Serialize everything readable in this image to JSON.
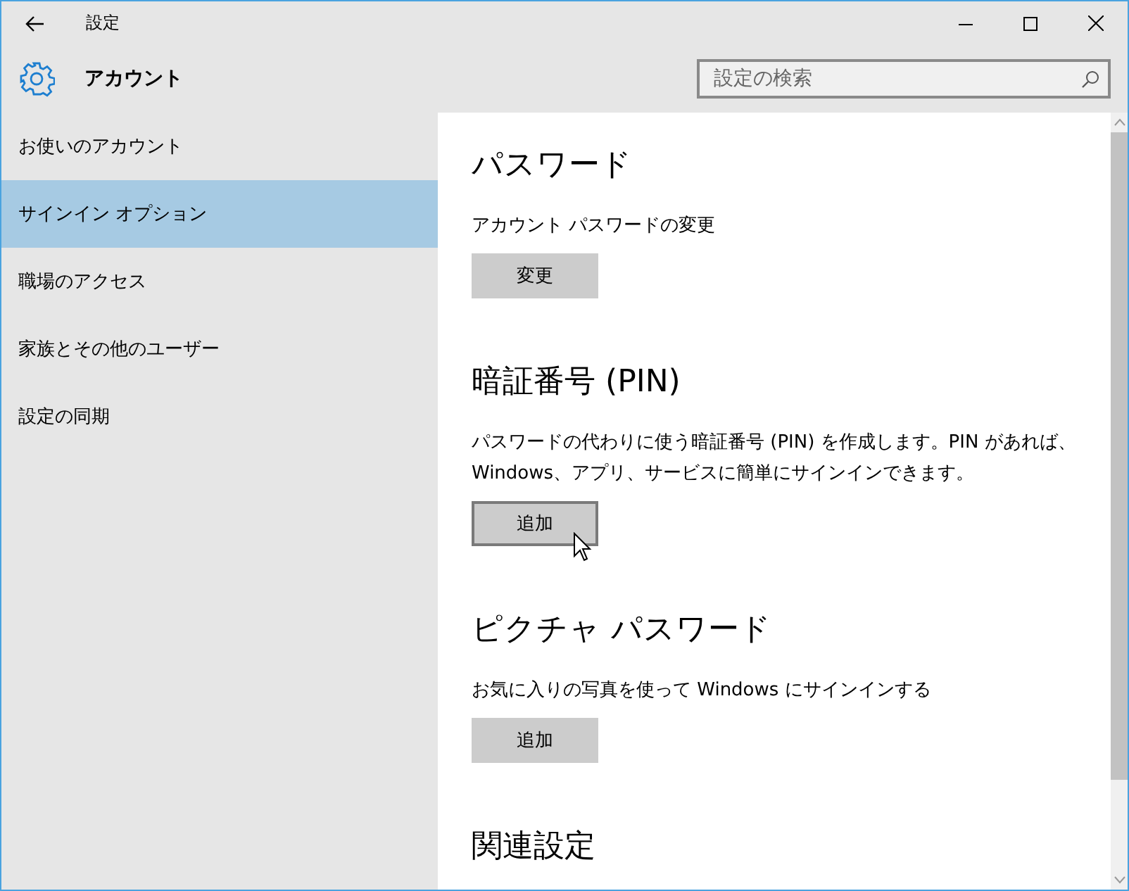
{
  "window": {
    "title": "設定"
  },
  "header": {
    "title": "アカウント",
    "search": {
      "placeholder": "設定の検索"
    }
  },
  "sidebar": {
    "items": [
      {
        "label": "お使いのアカウント",
        "selected": false
      },
      {
        "label": "サインイン オプション",
        "selected": true
      },
      {
        "label": "職場のアクセス",
        "selected": false
      },
      {
        "label": "家族とその他のユーザー",
        "selected": false
      },
      {
        "label": "設定の同期",
        "selected": false
      }
    ]
  },
  "sections": [
    {
      "heading": "パスワード",
      "description": "アカウント パスワードの変更",
      "button": {
        "label": "変更",
        "hovered": false
      }
    },
    {
      "heading": "暗証番号 (PIN)",
      "description": "パスワードの代わりに使う暗証番号 (PIN) を作成します。PIN があれば、Windows、アプリ、サービスに簡単にサインインできます。",
      "button": {
        "label": "追加",
        "hovered": true
      }
    },
    {
      "heading": "ピクチャ パスワード",
      "description": "お気に入りの写真を使って Windows にサインインする",
      "button": {
        "label": "追加",
        "hovered": false
      }
    },
    {
      "heading": "関連設定"
    }
  ]
}
